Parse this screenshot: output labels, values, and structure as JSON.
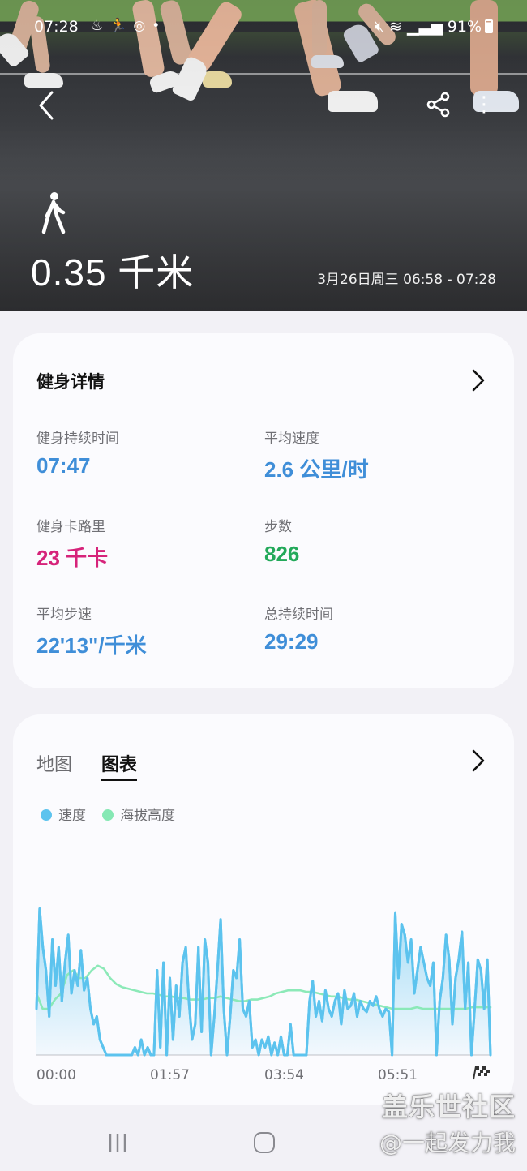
{
  "status_bar": {
    "time": "07:28",
    "notification_icons": [
      "fitness-icon",
      "running-icon",
      "sync-icon",
      "dot-icon"
    ],
    "battery": "91%"
  },
  "hero": {
    "distance": "0.35 千米",
    "date_range": "3月26日周三 06:58 - 07:28",
    "activity_icon": "walking-person-icon"
  },
  "details": {
    "title": "健身详情",
    "metrics": [
      {
        "label": "健身持续时间",
        "value": "07:47",
        "color": "#3f8ed8"
      },
      {
        "label": "平均速度",
        "value": "2.6 公里/时",
        "color": "#3f8ed8"
      },
      {
        "label": "健身卡路里",
        "value": "23 千卡",
        "color": "#d6237a"
      },
      {
        "label": "步数",
        "value": "826",
        "color": "#23a95a"
      },
      {
        "label": "平均步速",
        "value": "22'13\"/千米",
        "color": "#3f8ed8"
      },
      {
        "label": "总持续时间",
        "value": "29:29",
        "color": "#3f8ed8"
      }
    ]
  },
  "chart_card": {
    "tabs": [
      {
        "label": "地图",
        "active": false
      },
      {
        "label": "图表",
        "active": true
      }
    ],
    "legend": [
      {
        "label": "速度",
        "color": "#5cc3ee"
      },
      {
        "label": "海拔高度",
        "color": "#86e8b4"
      }
    ]
  },
  "chart_data": {
    "type": "line",
    "x_tick_labels": [
      "00:00",
      "01:57",
      "03:54",
      "05:51"
    ],
    "end_marker": "finish-flag-icon",
    "grid": false,
    "series": [
      {
        "name": "速度",
        "color": "#5cc3ee",
        "fill": "area",
        "values": [
          0.3,
          0.95,
          0.7,
          0.55,
          0.25,
          0.75,
          0.45,
          0.7,
          0.35,
          0.6,
          0.78,
          0.4,
          0.55,
          0.45,
          0.68,
          0.42,
          0.5,
          0.3,
          0.2,
          0.25,
          0.1,
          0.05,
          0.0,
          0.0,
          0.0,
          0.0,
          0.0,
          0.0,
          0.0,
          0.0,
          0.0,
          0.05,
          0.0,
          0.1,
          0.0,
          0.05,
          0.0,
          0.0,
          0.55,
          0.05,
          0.6,
          0.0,
          0.5,
          0.1,
          0.45,
          0.25,
          0.6,
          0.7,
          0.35,
          0.1,
          0.2,
          0.7,
          0.15,
          0.75,
          0.6,
          0.0,
          0.25,
          0.55,
          0.88,
          0.3,
          0.0,
          0.25,
          0.55,
          0.5,
          0.75,
          0.3,
          0.25,
          0.35,
          0.05,
          0.1,
          0.0,
          0.1,
          0.05,
          0.12,
          0.0,
          0.08,
          0.0,
          0.12,
          0.0,
          0.0,
          0.2,
          0.0,
          0.0,
          0.0,
          0.0,
          0.0,
          0.35,
          0.48,
          0.25,
          0.35,
          0.22,
          0.42,
          0.3,
          0.25,
          0.35,
          0.4,
          0.2,
          0.42,
          0.3,
          0.32,
          0.4,
          0.25,
          0.35,
          0.3,
          0.28,
          0.35,
          0.32,
          0.38,
          0.3,
          0.25,
          0.3,
          0.28,
          0.0,
          0.92,
          0.5,
          0.85,
          0.78,
          0.6,
          0.75,
          0.4,
          0.55,
          0.7,
          0.6,
          0.5,
          0.45,
          0.6,
          0.0,
          0.35,
          0.5,
          0.78,
          0.62,
          0.2,
          0.5,
          0.62,
          0.8,
          0.3,
          0.6,
          0.0,
          0.3,
          0.62,
          0.55,
          0.3,
          0.62,
          0.0
        ]
      },
      {
        "name": "海拔高度",
        "color": "#86e8b4",
        "fill": "none",
        "values": [
          0.4,
          0.3,
          0.3,
          0.36,
          0.4,
          0.52,
          0.55,
          0.5,
          0.5,
          0.55,
          0.58,
          0.56,
          0.5,
          0.46,
          0.44,
          0.43,
          0.42,
          0.41,
          0.4,
          0.4,
          0.39,
          0.38,
          0.38,
          0.37,
          0.37,
          0.36,
          0.36,
          0.36,
          0.37,
          0.37,
          0.38,
          0.37,
          0.36,
          0.35,
          0.35,
          0.36,
          0.36,
          0.37,
          0.38,
          0.4,
          0.41,
          0.42,
          0.42,
          0.42,
          0.41,
          0.41,
          0.4,
          0.39,
          0.38,
          0.38,
          0.37,
          0.36,
          0.36,
          0.35,
          0.34,
          0.33,
          0.32,
          0.31,
          0.3,
          0.3,
          0.3,
          0.3,
          0.31,
          0.3,
          0.3,
          0.3,
          0.3,
          0.3,
          0.3,
          0.3,
          0.3,
          0.31,
          0.31,
          0.31,
          0.31
        ]
      }
    ]
  },
  "navbar": {
    "buttons": [
      "recent-apps-icon",
      "home-icon",
      "back-icon"
    ]
  },
  "watermark": {
    "line1": "盖乐世社区",
    "line2": "@一起发力我"
  }
}
